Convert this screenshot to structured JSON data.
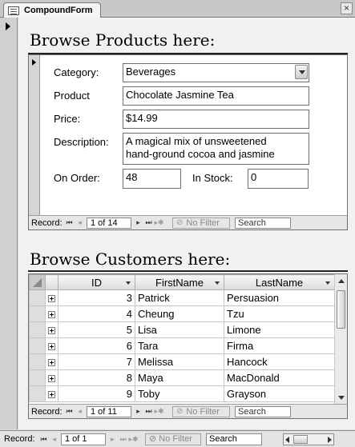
{
  "window": {
    "tab_title": "CompoundForm",
    "close_glyph": "×"
  },
  "products": {
    "heading": "Browse Products here:",
    "labels": {
      "category": "Category:",
      "product": "Product",
      "price": "Price:",
      "description": "Description:",
      "on_order": "On Order:",
      "in_stock": "In Stock:"
    },
    "values": {
      "category": "Beverages",
      "product": "Chocolate Jasmine Tea",
      "price": "$14.99",
      "description_line1": "A magical mix of unsweetened",
      "description_line2": "hand-ground cocoa and jasmine",
      "on_order": "48",
      "in_stock": "0"
    },
    "nav": {
      "record_label": "Record:",
      "position": "1 of 14",
      "no_filter": "No Filter",
      "search": "Search"
    }
  },
  "customers": {
    "heading": "Browse Customers here:",
    "columns": [
      "ID",
      "FirstName",
      "LastName"
    ],
    "rows": [
      {
        "id": "3",
        "first": "Patrick",
        "last": "Persuasion"
      },
      {
        "id": "4",
        "first": "Cheung",
        "last": "Tzu"
      },
      {
        "id": "5",
        "first": "Lisa",
        "last": "Limone"
      },
      {
        "id": "6",
        "first": "Tara",
        "last": "Firma"
      },
      {
        "id": "7",
        "first": "Melissa",
        "last": "Hancock"
      },
      {
        "id": "8",
        "first": "Maya",
        "last": "MacDonald"
      },
      {
        "id": "9",
        "first": "Toby",
        "last": "Grayson"
      }
    ],
    "nav": {
      "record_label": "Record:",
      "position": "1 of 11",
      "no_filter": "No Filter",
      "search": "Search"
    }
  },
  "outer_nav": {
    "record_label": "Record:",
    "position": "1 of 1",
    "no_filter": "No Filter",
    "search": "Search"
  },
  "icons": {
    "first": "⏮",
    "prev": "◂",
    "next": "▸",
    "last": "⏭",
    "new": "▸✱",
    "filter": "⊘"
  }
}
